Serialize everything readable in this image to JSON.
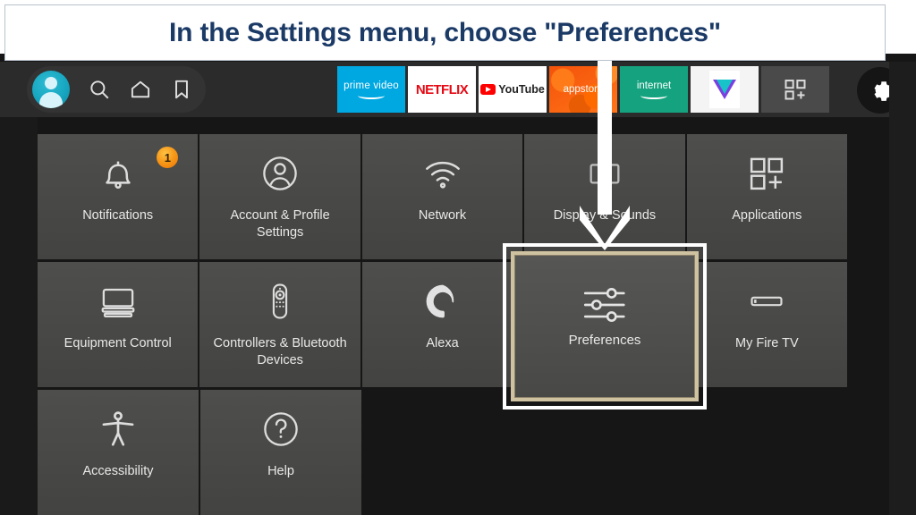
{
  "banner": {
    "text": "In the Settings menu, choose \"Preferences\"",
    "text_color": "#1b3a66",
    "background": "#ffffff"
  },
  "topbar": {
    "background": "#2b2b2b",
    "left_icons": [
      {
        "name": "profile-avatar",
        "label": "Profile"
      },
      {
        "name": "search-icon",
        "label": "Search"
      },
      {
        "name": "home-icon",
        "label": "Home"
      },
      {
        "name": "bookmark-icon",
        "label": "Watchlist"
      }
    ],
    "apps": [
      {
        "name": "prime-video",
        "label": "prime video",
        "color": "#00a8e1"
      },
      {
        "name": "netflix",
        "label": "NETFLIX",
        "color": "#e50914"
      },
      {
        "name": "youtube",
        "label": "YouTube",
        "color": "#ff0000"
      },
      {
        "name": "appstore",
        "label": "appstore",
        "color": "#f4520a"
      },
      {
        "name": "internet",
        "label": "internet",
        "color": "#15a37f"
      }
    ],
    "app_grid_label": "Apps",
    "settings": {
      "name": "settings-gear",
      "label": "Settings",
      "badge_color": "#f08c12"
    }
  },
  "grid": {
    "rows": [
      [
        {
          "label": "Notifications",
          "icon": "bell-icon",
          "badge": "1"
        },
        {
          "label": "Account & Profile Settings",
          "icon": "person-circle-icon",
          "badge": ""
        },
        {
          "label": "Network",
          "icon": "wifi-icon",
          "badge": ""
        },
        {
          "label": "Display & Sounds",
          "icon": "display-icon",
          "badge": ""
        },
        {
          "label": "Applications",
          "icon": "apps-grid-icon",
          "badge": ""
        }
      ],
      [
        {
          "label": "Equipment Control",
          "icon": "tv-soundbar-icon",
          "badge": ""
        },
        {
          "label": "Controllers & Bluetooth Devices",
          "icon": "remote-icon",
          "badge": ""
        },
        {
          "label": "Alexa",
          "icon": "alexa-icon",
          "badge": ""
        },
        {
          "label": "Preferences",
          "icon": "sliders-icon",
          "badge": ""
        },
        {
          "label": "My Fire TV",
          "icon": "firetv-stick-icon",
          "badge": ""
        }
      ],
      [
        {
          "label": "Accessibility",
          "icon": "accessibility-icon",
          "badge": ""
        },
        {
          "label": "Help",
          "icon": "question-circle-icon",
          "badge": ""
        }
      ]
    ],
    "selected": {
      "label": "Preferences",
      "icon": "sliders-icon",
      "highlight_border_color": "#ffffff",
      "focus_border_color": "#cfc2a1"
    },
    "tile_color": "#4a4a48"
  },
  "annotation": {
    "arrow": "down-arrow-annotation",
    "arrow_color": "#ffffff",
    "points_to": "Preferences"
  }
}
